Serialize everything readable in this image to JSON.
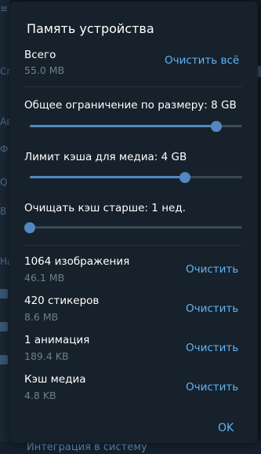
{
  "dialog": {
    "title": "Память устройства",
    "total": {
      "label": "Всего",
      "size": "55.0 MB",
      "clear_all": "Очистить всё"
    },
    "sliders": [
      {
        "label": "Общее ограничение по размеру: 8 GB",
        "level": 0.88
      },
      {
        "label": "Лимит кэша для медиа: 4 GB",
        "level": 0.73
      },
      {
        "label": "Очищать кэш старше: 1 нед.",
        "level": 0.0
      }
    ],
    "categories": [
      {
        "label": "1064 изображения",
        "size": "46.1 MB",
        "action": "Очистить"
      },
      {
        "label": "420 стикеров",
        "size": "8.6 MB",
        "action": "Очистить"
      },
      {
        "label": "1 анимация",
        "size": "189.4 KB",
        "action": "Очистить"
      },
      {
        "label": "Кэш медиа",
        "size": "4.8 KB",
        "action": "Очистить"
      }
    ],
    "ok_label": "OK"
  },
  "background": {
    "bottom_text": "Интеграция в систему",
    "glyphs": [
      "≡",
      "Сп",
      "Ав",
      "Ф",
      "Q",
      "В",
      "На"
    ]
  },
  "colors": {
    "dialog_bg": "#17212b",
    "accent": "#5eb5f7",
    "slider": "#5288c1",
    "muted_text": "#6d7f8f"
  }
}
